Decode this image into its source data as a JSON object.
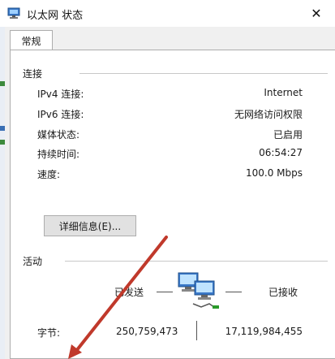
{
  "window": {
    "title": "以太网 状态",
    "close_glyph": "✕"
  },
  "tabs": [
    {
      "label": "常规"
    }
  ],
  "connection": {
    "header": "连接",
    "rows": [
      {
        "label": "IPv4 连接:",
        "value": "Internet"
      },
      {
        "label": "IPv6 连接:",
        "value": "无网络访问权限"
      },
      {
        "label": "媒体状态:",
        "value": "已启用"
      },
      {
        "label": "持续时间:",
        "value": "06:54:27"
      },
      {
        "label": "速度:",
        "value": "100.0 Mbps"
      }
    ],
    "details_button": "详细信息(E)..."
  },
  "activity": {
    "header": "活动",
    "sent_label": "已发送",
    "received_label": "已接收",
    "bytes_label": "字节:",
    "bytes_sent": "250,759,473",
    "bytes_received": "17,119,984,455"
  },
  "icons": {
    "title": "network-adapter-icon",
    "activity": "network-computers-icon",
    "annotation": "red-arrow-annotation"
  },
  "colors": {
    "accent_red": "#c0392b",
    "tab_border": "#adadad",
    "panel_bg": "#f0f0f0"
  }
}
